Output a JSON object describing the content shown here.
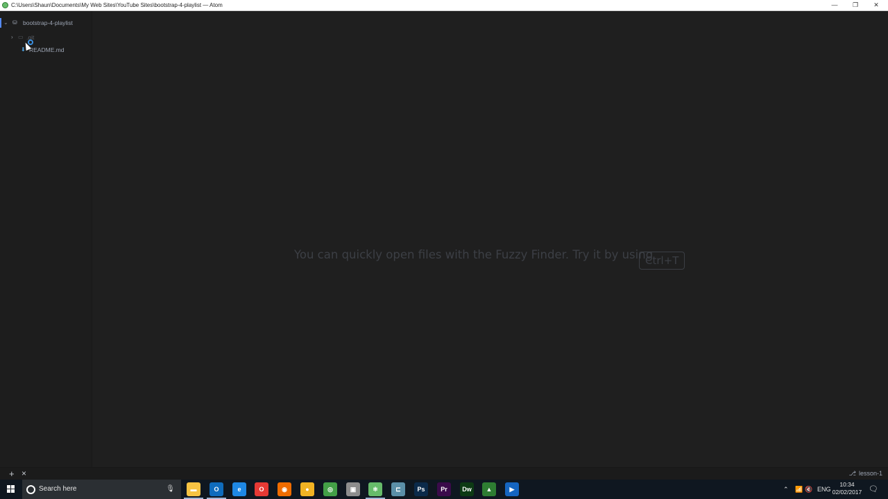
{
  "window": {
    "title": "C:\\Users\\Shaun\\Documents\\My Web Sites\\YouTube Sites\\bootstrap-4-playlist — Atom",
    "minimize": "—",
    "maximize": "❐",
    "close": "✕"
  },
  "tree": {
    "root_label": "bootstrap-4-playlist",
    "items": [
      {
        "label": ".git",
        "icon": "folder-icon",
        "collapsed": true
      },
      {
        "label": "README.md",
        "icon": "markdown-file-icon"
      }
    ]
  },
  "editor": {
    "hint_text": "You can quickly open files with the Fuzzy Finder. Try it by using",
    "shortcut": "Ctrl+T"
  },
  "statusbar": {
    "add_label": "+",
    "close_label": "×",
    "branch": "lesson-1"
  },
  "taskbar": {
    "search_placeholder": "Search here",
    "language": "ENG",
    "time": "10:34",
    "date": "02/02/2017",
    "apps": [
      {
        "name": "file-explorer",
        "color": "#f6c343",
        "glyph": "▬"
      },
      {
        "name": "outlook",
        "color": "#0f6cbd",
        "glyph": "O"
      },
      {
        "name": "edge",
        "color": "#1e88e5",
        "glyph": "e"
      },
      {
        "name": "opera",
        "color": "#e53935",
        "glyph": "O"
      },
      {
        "name": "firefox",
        "color": "#ef6c00",
        "glyph": "◉"
      },
      {
        "name": "app-yellow",
        "color": "#f0b323",
        "glyph": "●"
      },
      {
        "name": "chrome",
        "color": "#43a047",
        "glyph": "◎"
      },
      {
        "name": "app-gray",
        "color": "#8d8d8d",
        "glyph": "▣"
      },
      {
        "name": "atom",
        "color": "#66bb6a",
        "glyph": "⚛"
      },
      {
        "name": "app-terminal",
        "color": "#5b8fa8",
        "glyph": "⊏"
      },
      {
        "name": "photoshop",
        "color": "#0b2a4a",
        "glyph": "Ps"
      },
      {
        "name": "premiere",
        "color": "#3a0b4a",
        "glyph": "Pr"
      },
      {
        "name": "dreamweaver",
        "color": "#0d3a14",
        "glyph": "Dw"
      },
      {
        "name": "app-green",
        "color": "#2e7d32",
        "glyph": "▲"
      },
      {
        "name": "app-blue",
        "color": "#1565c0",
        "glyph": "▶"
      }
    ]
  },
  "colors": {
    "accent": "#568af2",
    "background": "#1f1f1f",
    "taskbar": "#0f1720"
  }
}
